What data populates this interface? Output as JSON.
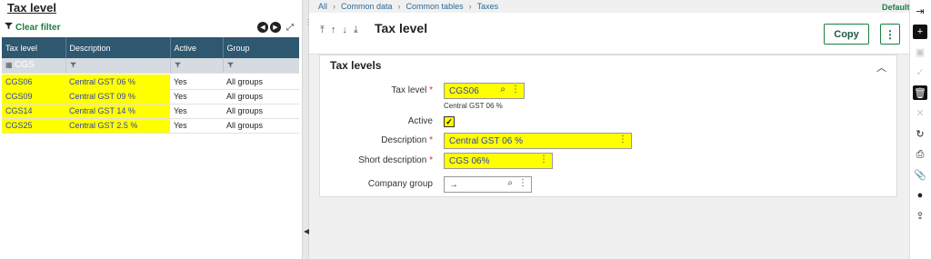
{
  "left_panel": {
    "title": "Tax level",
    "clear_filter": "Clear filter",
    "columns": [
      "Tax level",
      "Description",
      "Active",
      "Group"
    ],
    "filter_value": "CGS",
    "rows": [
      {
        "tax_level": "CGS06",
        "description": "Central GST 06 %",
        "active": "Yes",
        "group": "All groups"
      },
      {
        "tax_level": "CGS09",
        "description": "Central GST 09 %",
        "active": "Yes",
        "group": "All groups"
      },
      {
        "tax_level": "CGS14",
        "description": "Central GST 14 %",
        "active": "Yes",
        "group": "All groups"
      },
      {
        "tax_level": "CGS25",
        "description": "Central GST 2.5 %",
        "active": "Yes",
        "group": "All groups"
      }
    ]
  },
  "breadcrumb": [
    "All",
    "Common data",
    "Common tables",
    "Taxes"
  ],
  "default_selector": "Default",
  "header": {
    "title": "Tax level",
    "copy_label": "Copy",
    "more_label": "⋮"
  },
  "section": {
    "title": "Tax levels",
    "fields": {
      "tax_level_label": "Tax level",
      "tax_level_value": "CGS06",
      "tax_level_desc": "Central GST 06 %",
      "active_label": "Active",
      "description_label": "Description",
      "description_value": "Central GST 06 %",
      "short_description_label": "Short description",
      "short_description_value": "CGS 06%",
      "company_group_label": "Company group",
      "company_group_value": "→"
    }
  },
  "colors": {
    "header_blue": "#2e5770",
    "highlight_yellow": "#ffff00",
    "accent_green": "#1a7f3c"
  }
}
